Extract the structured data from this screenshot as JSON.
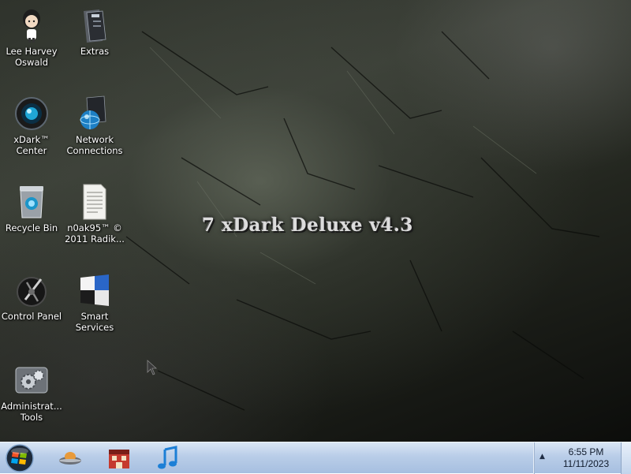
{
  "desktop": {
    "watermark": "7 xDark Deluxe v4.3",
    "icons": [
      {
        "label": "Lee Harvey Oswald",
        "icon": "user-figure-icon"
      },
      {
        "label": "Extras",
        "icon": "folder-icon"
      },
      {
        "label": "xDark™ Center",
        "icon": "camera-lens-icon"
      },
      {
        "label": "Network Connections",
        "icon": "network-globe-icon"
      },
      {
        "label": "Recycle Bin",
        "icon": "recycle-bin-icon"
      },
      {
        "label": "n0ak95™ © 2011 Radik...",
        "icon": "document-icon"
      },
      {
        "label": "Control Panel",
        "icon": "control-panel-icon"
      },
      {
        "label": "Smart Services",
        "icon": "smart-services-icon"
      },
      {
        "label": "Administrat... Tools",
        "icon": "gears-icon"
      }
    ]
  },
  "taskbar": {
    "apps": [
      {
        "icon": "ufo-icon"
      },
      {
        "icon": "store-icon"
      },
      {
        "icon": "music-note-icon"
      }
    ],
    "tray": {
      "time": "6:55 PM",
      "date": "11/11/2023"
    }
  },
  "colors": {
    "taskbar": "#b9cde8",
    "icon_label": "#ffffff"
  }
}
